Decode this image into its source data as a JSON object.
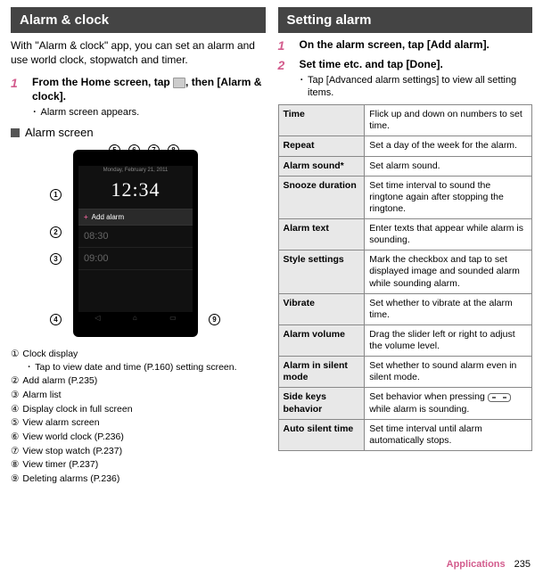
{
  "left": {
    "banner": "Alarm & clock",
    "intro": "With \"Alarm & clock\" app, you can set an alarm and use world clock, stopwatch and timer.",
    "step1_num": "1",
    "step1_title_a": "From the Home screen, tap ",
    "step1_title_b": ", then [Alarm & clock].",
    "step1_bullet": "Alarm screen appears.",
    "sub_h": "Alarm screen",
    "phone": {
      "date": "Monday, February 21, 2011",
      "time": "12:34",
      "add": "Add alarm",
      "a1": "08:30",
      "a2": "09:00"
    },
    "callouts": {
      "c1": "1",
      "c2": "2",
      "c3": "3",
      "c4": "4",
      "c5": "5",
      "c6": "6",
      "c7": "7",
      "c8": "8",
      "c9": "9"
    },
    "legend": {
      "l1n": "①",
      "l1": "Clock display",
      "l1b": "Tap to view date and time (P.160) setting screen.",
      "l2n": "②",
      "l2": "Add alarm (P.235)",
      "l3n": "③",
      "l3": "Alarm list",
      "l4n": "④",
      "l4": "Display clock in full screen",
      "l5n": "⑤",
      "l5": "View alarm screen",
      "l6n": "⑥",
      "l6": "View world clock (P.236)",
      "l7n": "⑦",
      "l7": "View stop watch (P.237)",
      "l8n": "⑧",
      "l8": "View timer (P.237)",
      "l9n": "⑨",
      "l9": "Deleting alarms (P.236)"
    }
  },
  "right": {
    "banner": "Setting alarm",
    "step1_num": "1",
    "step1_title": "On the alarm screen, tap [Add alarm].",
    "step2_num": "2",
    "step2_title": "Set time etc. and tap [Done].",
    "step2_bullet": "Tap [Advanced alarm settings] to view all setting items.",
    "table": {
      "r1h": "Time",
      "r1": "Flick up and down on numbers to set time.",
      "r2h": "Repeat",
      "r2": "Set a day of the week for the alarm.",
      "r3h": "Alarm sound*",
      "r3": "Set alarm sound.",
      "r4h": "Snooze duration",
      "r4": "Set time interval to sound the ringtone again after stopping the ringtone.",
      "r5h": "Alarm text",
      "r5": "Enter texts that appear while alarm is sounding.",
      "r6h": "Style settings",
      "r6": "Mark the checkbox and tap to set displayed image and sounded alarm while sounding alarm.",
      "r7h": "Vibrate",
      "r7": "Set whether to vibrate at the alarm time.",
      "r8h": "Alarm volume",
      "r8": "Drag the slider left or right to adjust the volume level.",
      "r9h": "Alarm in silent mode",
      "r9": "Set whether to sound alarm even in silent mode.",
      "r10h": "Side keys behavior",
      "r10a": "Set behavior when pressing ",
      "r10b": " while alarm is sounding.",
      "r11h": "Auto silent time",
      "r11": "Set time interval until alarm automatically stops."
    }
  },
  "footer": {
    "app": "Applications",
    "page": "235"
  }
}
